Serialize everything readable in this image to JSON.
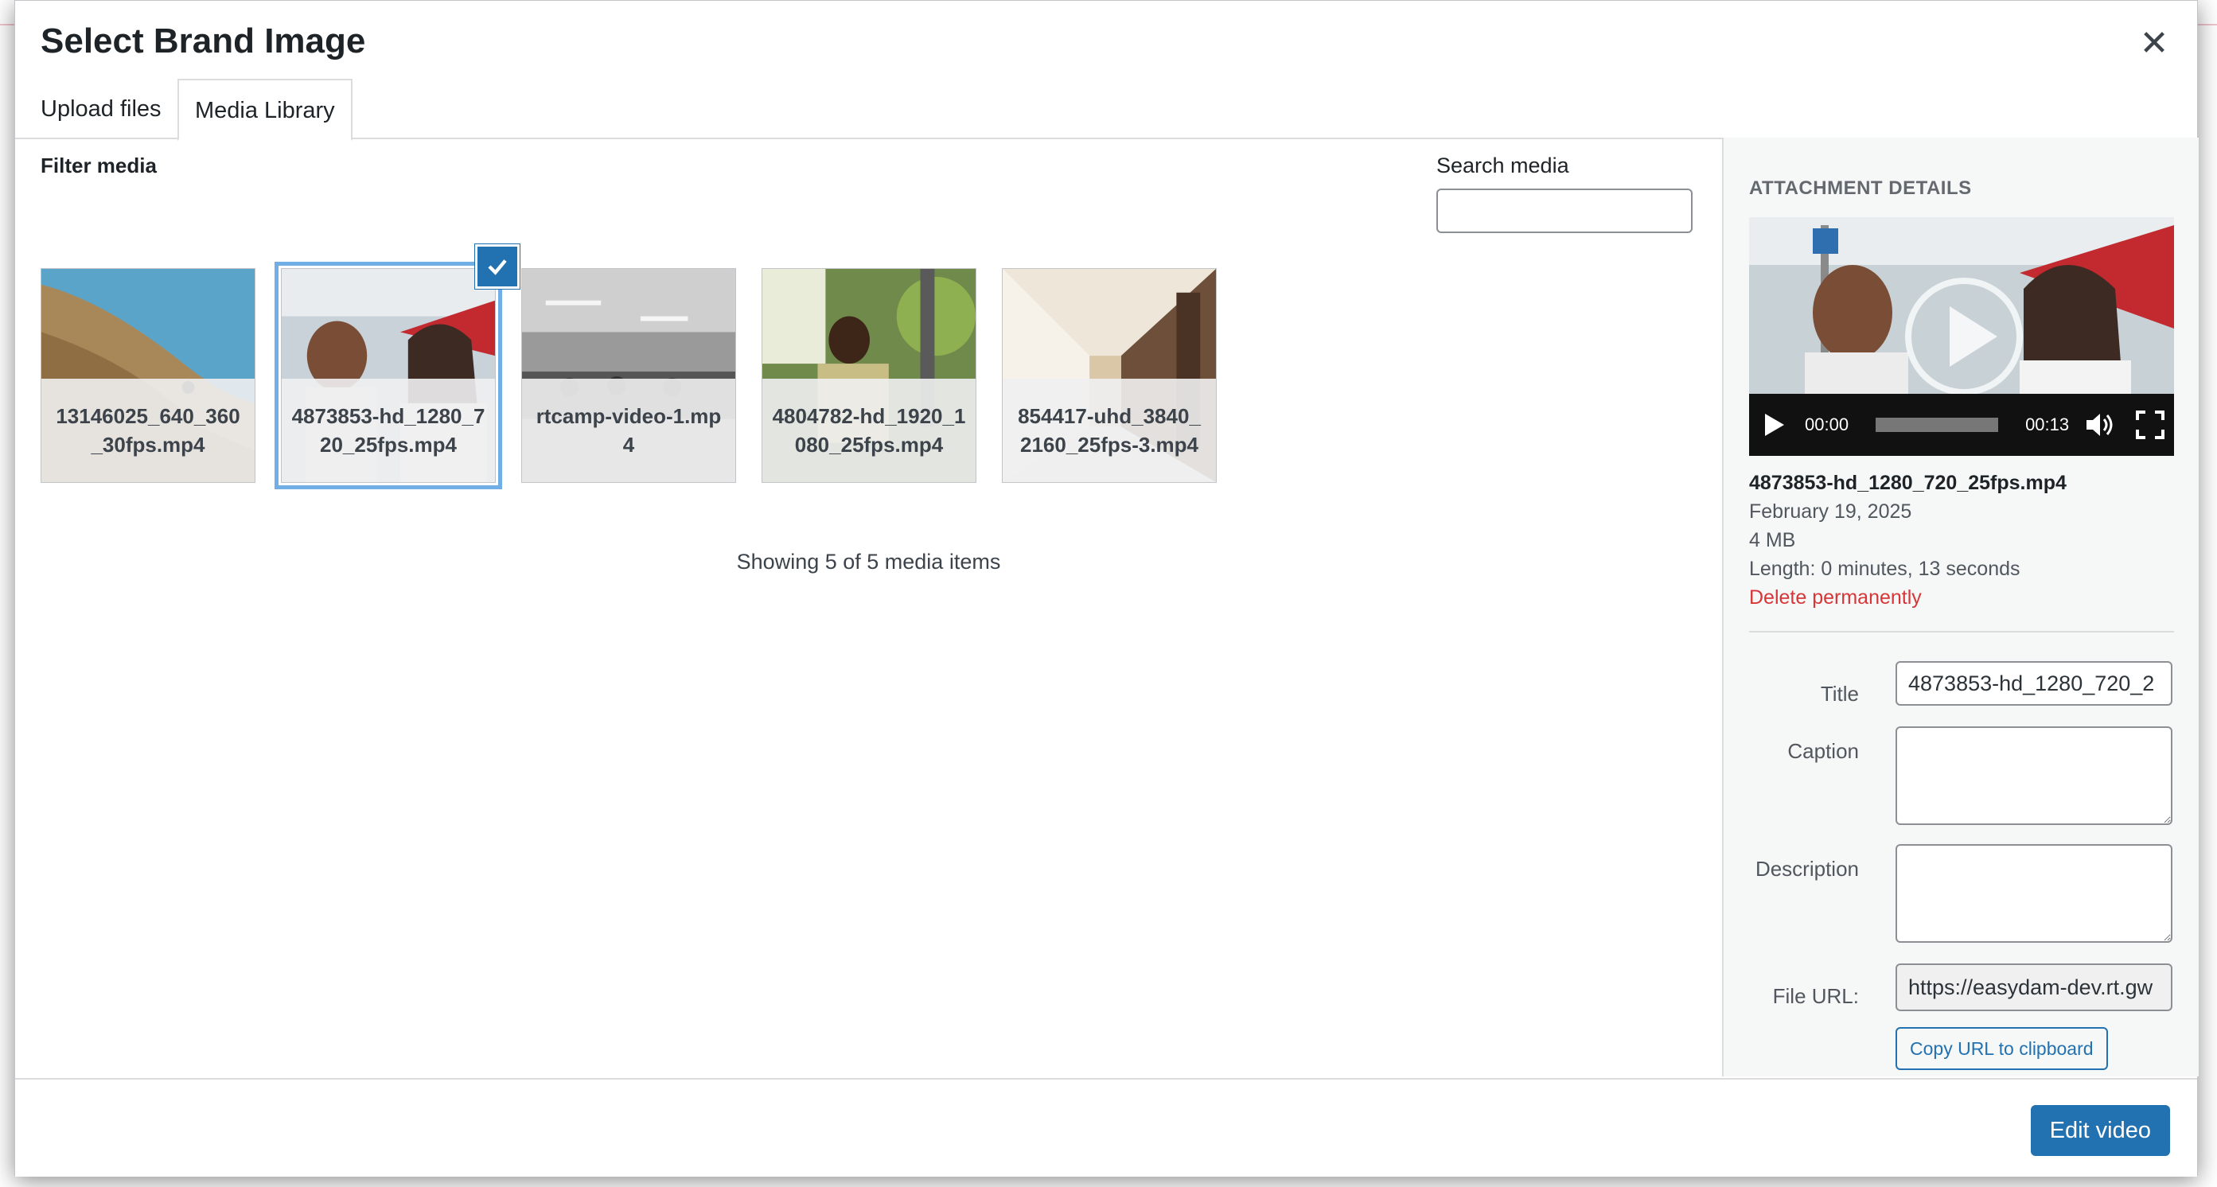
{
  "modal": {
    "title": "Select Brand Image",
    "close_icon": "close-icon"
  },
  "tabs": [
    {
      "label": "Upload files",
      "active": false
    },
    {
      "label": "Media Library",
      "active": true
    }
  ],
  "browser": {
    "filter_label": "Filter media",
    "search_label": "Search media",
    "search_value": "",
    "items": [
      {
        "name": "13146025_640_360_30fps.mp4",
        "selected": false
      },
      {
        "name": "4873853-hd_1280_720_25fps.mp4",
        "selected": true
      },
      {
        "name": "rtcamp-video-1.mp4",
        "selected": false
      },
      {
        "name": "4804782-hd_1920_1080_25fps.mp4",
        "selected": false
      },
      {
        "name": "854417-uhd_3840_2160_25fps-3.mp4",
        "selected": false
      }
    ],
    "showing_text": "Showing 5 of 5 media items"
  },
  "details": {
    "heading": "ATTACHMENT DETAILS",
    "player": {
      "current_time": "00:00",
      "duration": "00:13",
      "progress": 0
    },
    "filename": "4873853-hd_1280_720_25fps.mp4",
    "date": "February 19, 2025",
    "size": "4 MB",
    "length": "Length: 0 minutes, 13 seconds",
    "delete_label": "Delete permanently",
    "fields": {
      "title_label": "Title",
      "title_value": "4873853-hd_1280_720_2",
      "caption_label": "Caption",
      "caption_value": "",
      "description_label": "Description",
      "description_value": "",
      "url_label": "File URL:",
      "url_value": "https://easydam-dev.rt.gw"
    },
    "copy_label": "Copy URL to clipboard"
  },
  "toolbar": {
    "edit_label": "Edit video"
  },
  "colors": {
    "accent": "#2271b1",
    "selection": "#72aee6",
    "danger": "#d63638"
  }
}
